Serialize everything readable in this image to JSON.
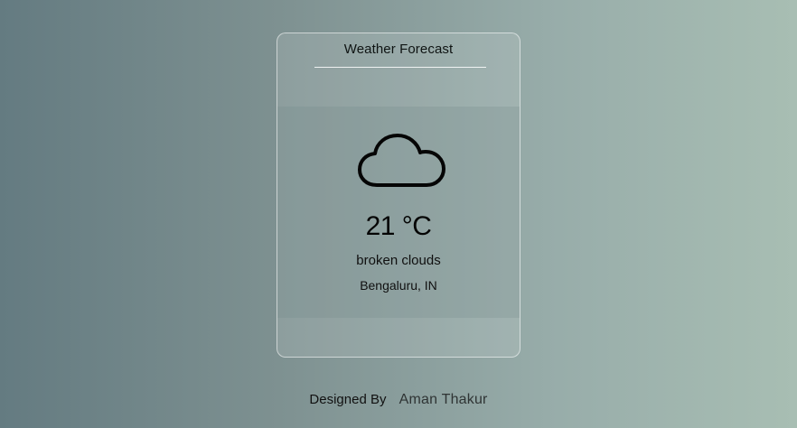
{
  "card": {
    "title": "Weather Forecast",
    "icon": "cloud-icon",
    "temperature": "21 °C",
    "description": "broken clouds",
    "location": "Bengaluru, IN"
  },
  "footer": {
    "label": "Designed By",
    "author": "Aman Thakur"
  },
  "colors": {
    "background_start": "#647b81",
    "background_end": "#a8beb3",
    "card_border": "#dfe7e7",
    "text": "#111111"
  }
}
